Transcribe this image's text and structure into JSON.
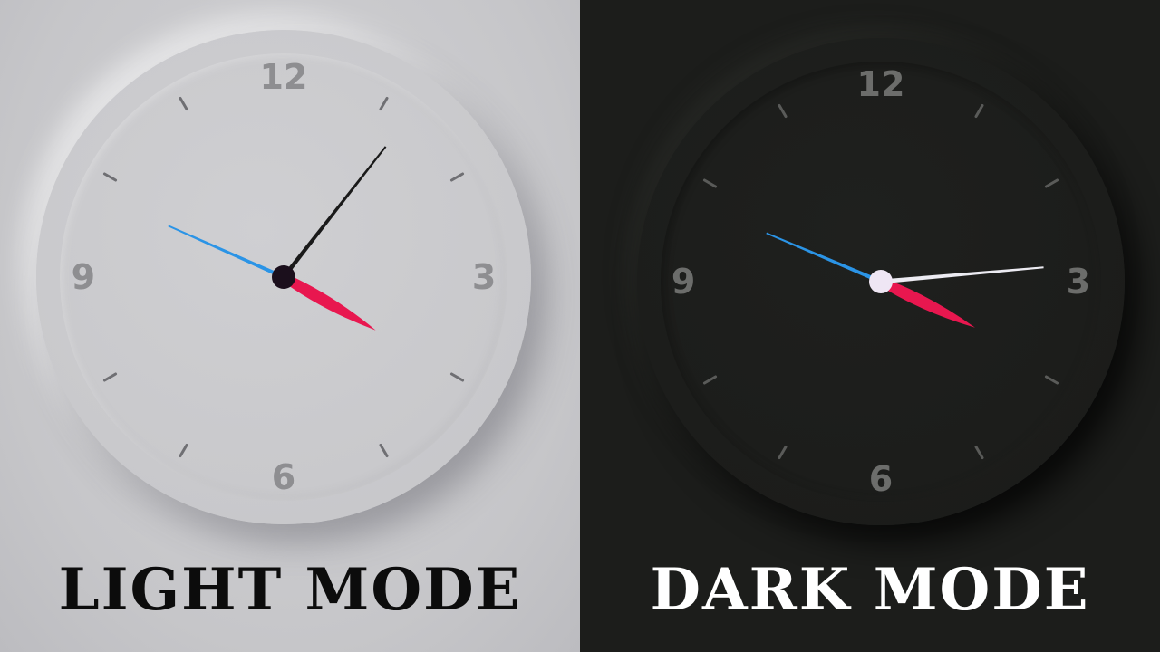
{
  "numerals": [
    "12",
    "3",
    "6",
    "9"
  ],
  "labels": {
    "light": "LIGHT MODE",
    "dark": "DARK MODE"
  },
  "clocks": {
    "light": {
      "hour_deg": 120,
      "minute_deg": 38,
      "second_deg": 294
    },
    "dark": {
      "hour_deg": 116,
      "minute_deg": 85,
      "second_deg": 293
    }
  },
  "colors": {
    "hour_hand": "#e8174f",
    "second_hand": "#2b94e6",
    "minute_hand_light": "#1a1a1a",
    "minute_hand_dark": "#ecebf2",
    "hub_light": "#1b0f1c",
    "hub_dark": "#efe6f4"
  }
}
